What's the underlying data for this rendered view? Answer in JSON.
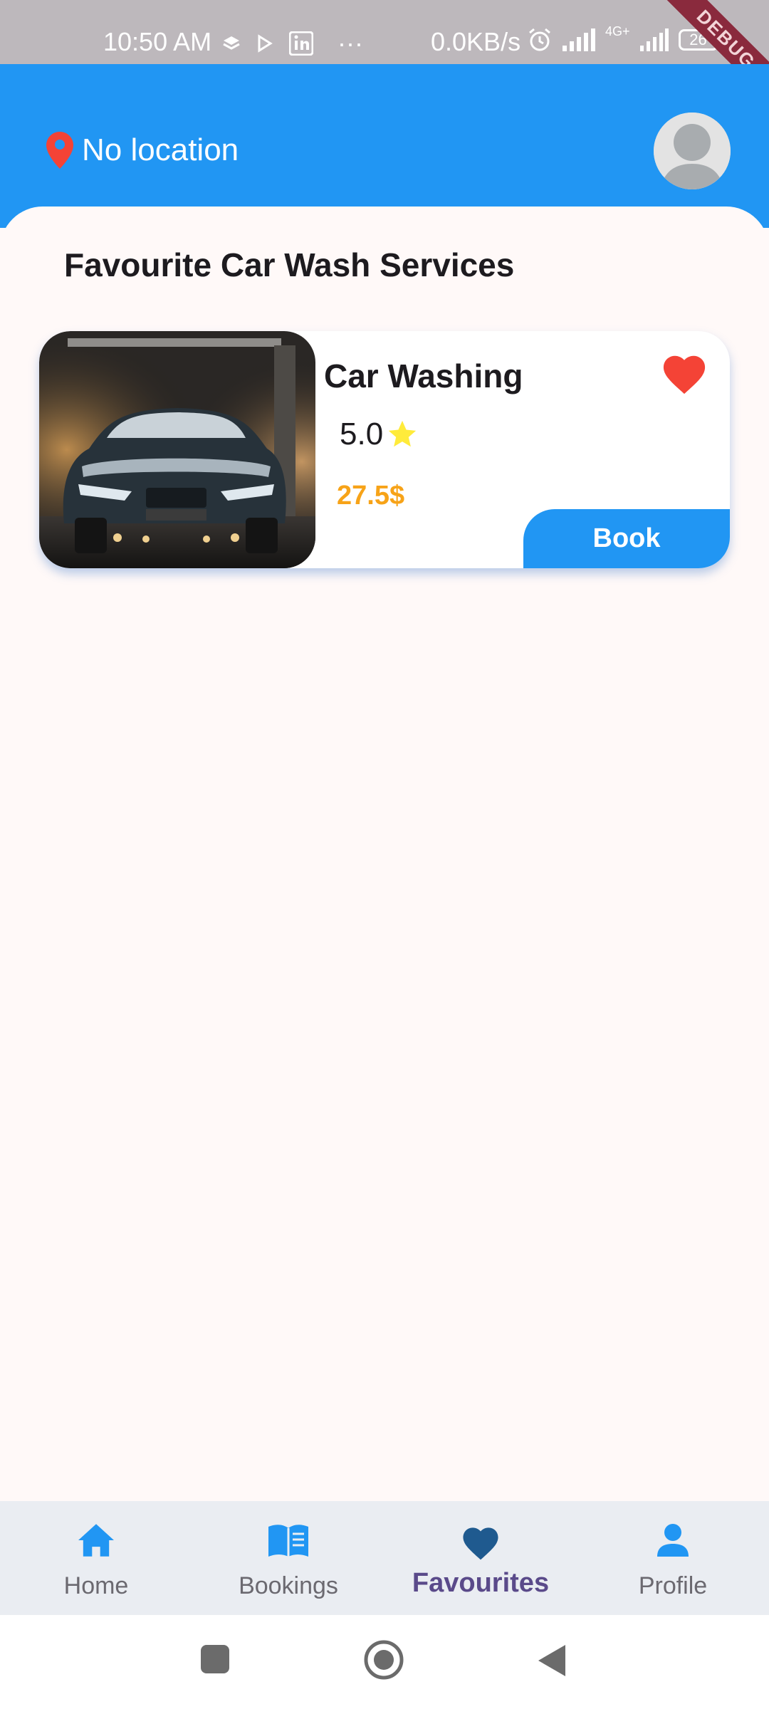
{
  "status_bar": {
    "time": "10:50 AM",
    "more": "···",
    "net_speed": "0.0KB/s",
    "network_type": "4G+",
    "battery": "26",
    "debug_label": "DEBUG"
  },
  "header": {
    "location_icon": "map-pin-icon",
    "location_text": "No location",
    "avatar_icon": "user-avatar-icon"
  },
  "main": {
    "section_title": "Favourite Car Wash Services",
    "favourites": [
      {
        "title": "Car Washing",
        "rating": "5.0",
        "price": "27.5$",
        "book_label": "Book",
        "favourite_icon": "heart-icon",
        "image": "car-wash-photo"
      }
    ]
  },
  "bottom_nav": {
    "items": [
      {
        "label": "Home",
        "icon": "home-icon"
      },
      {
        "label": "Bookings",
        "icon": "book-icon"
      },
      {
        "label": "Favourites",
        "icon": "heart-icon"
      },
      {
        "label": "Profile",
        "icon": "person-icon"
      }
    ],
    "active": "Favourites"
  },
  "colors": {
    "primary": "#2196f3",
    "heart": "#f44336",
    "price": "#f7a318",
    "star": "#ffeb3b",
    "active_nav_icon": "#1f5a8f",
    "active_nav_label": "#5a4a8a"
  }
}
